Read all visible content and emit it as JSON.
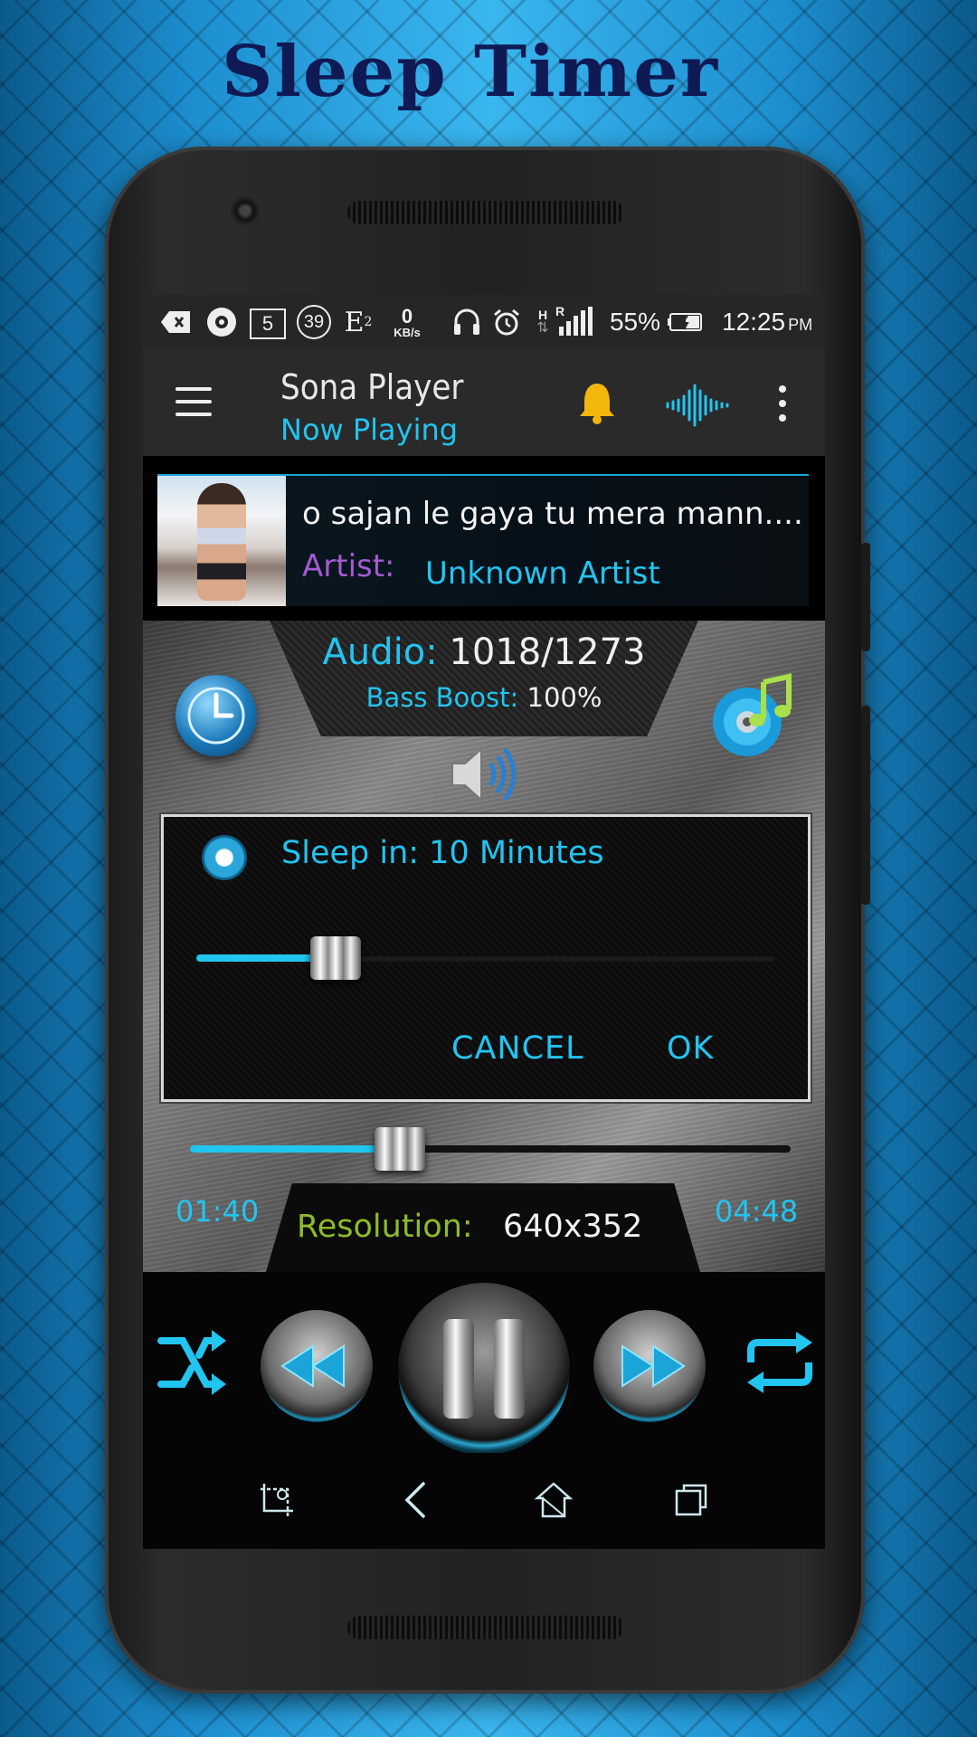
{
  "promo": {
    "title": "Sleep Timer"
  },
  "status_bar": {
    "notif_e": "E",
    "notif_e_sub": "2",
    "net_speed_value": "0",
    "net_speed_unit": "KB/s",
    "count_box": "5",
    "count_circle": "39",
    "signal_h": "H",
    "signal_r": "R",
    "battery": "55%",
    "time": "12:25",
    "ampm": "PM"
  },
  "app_bar": {
    "title": "Sona Player",
    "subtitle": "Now Playing"
  },
  "now_playing": {
    "song": "o sajan le gaya tu mera mann....",
    "artist_label": "Artist:",
    "artist": "Unknown Artist"
  },
  "audio_info": {
    "audio_label": "Audio:",
    "audio_value": "1018/1273",
    "bass_label": "Bass Boost:",
    "bass_value": "100%"
  },
  "sleep_dialog": {
    "title": "Sleep in: 10 Minutes",
    "slider_level": 0.24,
    "cancel": "CANCEL",
    "ok": "OK"
  },
  "playback": {
    "elapsed": "01:40",
    "total": "04:48",
    "progress": 0.35,
    "resolution_label": "Resolution:",
    "resolution_value": "640x352"
  },
  "colors": {
    "accent": "#22c4f0",
    "artist_label": "#a45ad0",
    "resolution_label": "#8dbb2a",
    "promo_title": "#0f1a55",
    "bell": "#f2b70d"
  }
}
